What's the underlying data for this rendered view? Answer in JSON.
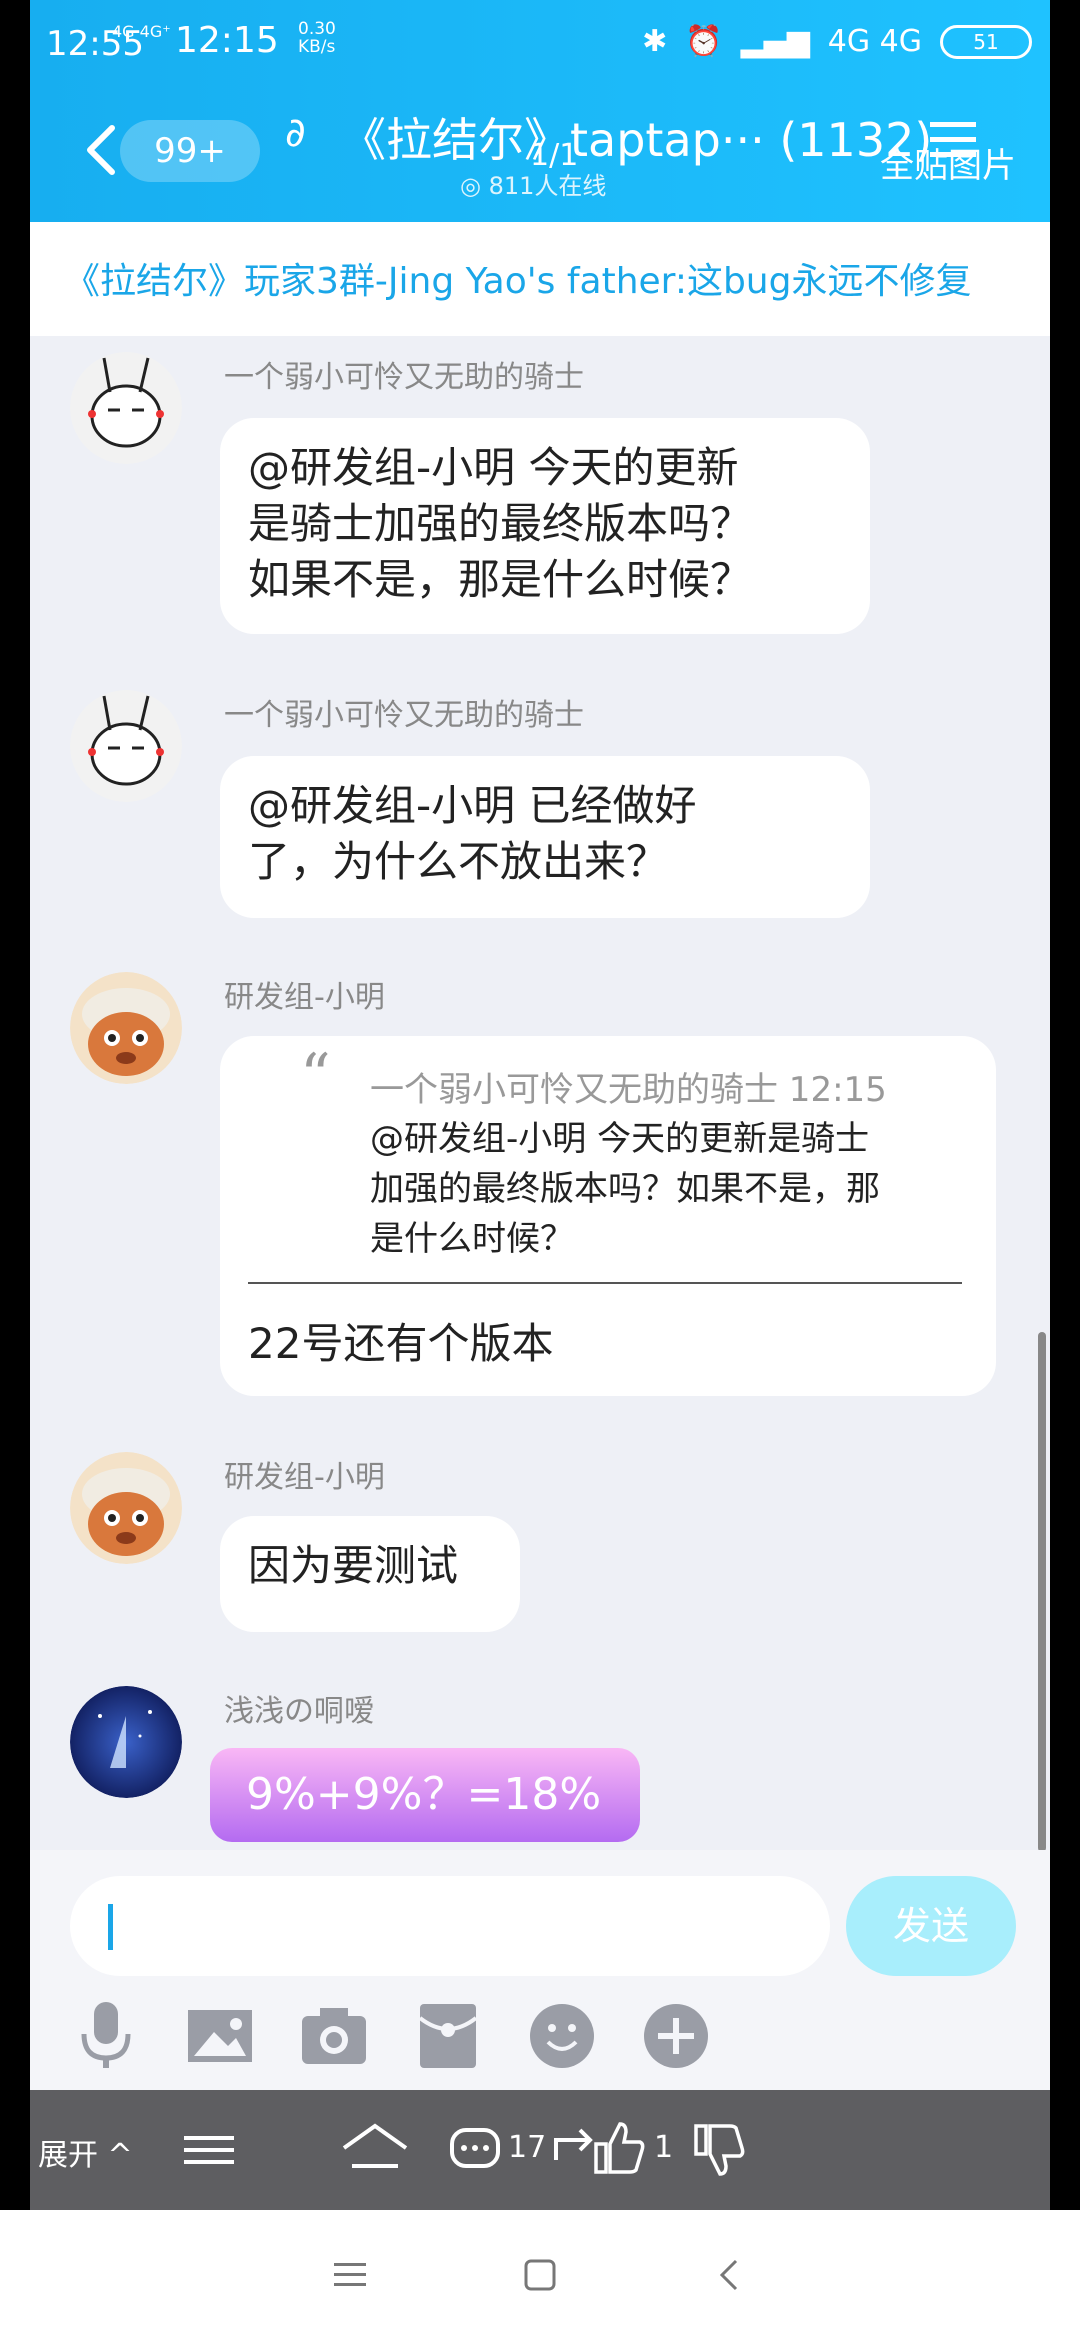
{
  "status": {
    "time_left": "12:55",
    "network_left": "4G 4G⁺",
    "time": "12:15",
    "speed": "0.30\nKB/s",
    "right_network": "4G 4G",
    "battery": "51"
  },
  "header": {
    "unread_badge": "99+",
    "title": "《拉结尔》taptap··· (1132)",
    "page_counter": "1/1",
    "online": "811人在线",
    "overlay_action": "全贴图片"
  },
  "notice": {
    "text": "《拉结尔》玩家3群-Jing Yao's father:这bug永远不修复"
  },
  "messages": [
    {
      "sender": "一个弱小可怜又无助的骑士",
      "lines": [
        "@研发组-小明 今天的更新",
        "是骑士加强的最终版本吗？",
        "如果不是，那是什么时候？"
      ]
    },
    {
      "sender": "一个弱小可怜又无助的骑士",
      "lines": [
        "@研发组-小明 已经做好",
        "了，为什么不放出来？"
      ]
    },
    {
      "sender": "研发组-小明",
      "quote_header": "一个弱小可怜又无助的骑士 12:15",
      "quote_lines": [
        "@研发组-小明 今天的更新是骑士",
        "加强的最终版本吗？如果不是，那",
        "是什么时候？"
      ],
      "reply": "22号还有个版本"
    },
    {
      "sender": "研发组-小明",
      "text": "因为要测试"
    },
    {
      "sender": "浅浅の哃嗳",
      "text": "9%+9%？=18%"
    }
  ],
  "input": {
    "send_label": "发送"
  },
  "toolbar": {
    "icons": [
      "microphone-icon",
      "image-icon",
      "camera-icon",
      "red-packet-icon",
      "emoji-icon",
      "plus-icon"
    ]
  },
  "appbar": {
    "expand_label": "展开 ^",
    "comment_count": "17",
    "like_count": "1"
  },
  "colors": {
    "header_blue": "#17aef0",
    "link_blue": "#1aa6e8",
    "send_disabled": "#a8eefc"
  }
}
